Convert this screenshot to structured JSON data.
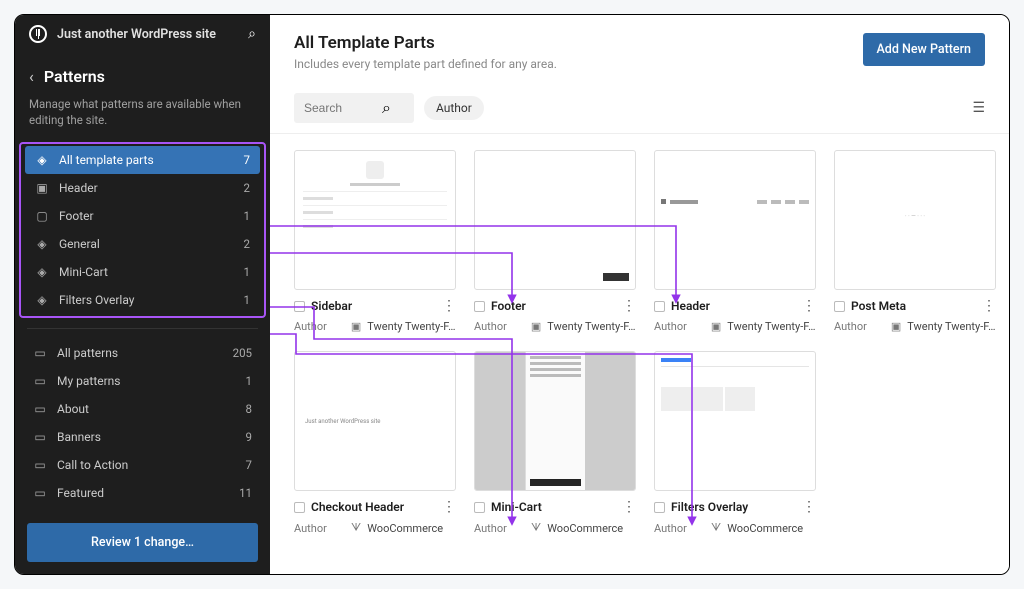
{
  "site_title": "Just another WordPress site",
  "sidebar": {
    "title": "Patterns",
    "description": "Manage what patterns are available when editing the site.",
    "template_parts": [
      {
        "icon": "◈",
        "label": "All template parts",
        "count": "7",
        "active": true
      },
      {
        "icon": "▣",
        "label": "Header",
        "count": "2"
      },
      {
        "icon": "▢",
        "label": "Footer",
        "count": "1"
      },
      {
        "icon": "◈",
        "label": "General",
        "count": "2"
      },
      {
        "icon": "◈",
        "label": "Mini-Cart",
        "count": "1"
      },
      {
        "icon": "◈",
        "label": "Filters Overlay",
        "count": "1"
      }
    ],
    "pattern_categories": [
      {
        "label": "All patterns",
        "count": "205"
      },
      {
        "label": "My patterns",
        "count": "1"
      },
      {
        "label": "About",
        "count": "8"
      },
      {
        "label": "Banners",
        "count": "9"
      },
      {
        "label": "Call to Action",
        "count": "7"
      },
      {
        "label": "Featured",
        "count": "11"
      }
    ],
    "review_label": "Review 1 change…"
  },
  "main": {
    "title": "All Template Parts",
    "subtitle": "Includes every template part defined for any area.",
    "add_button": "Add New Pattern",
    "search_placeholder": "Search",
    "filter_chip": "Author",
    "author_label": "Author",
    "theme_name": "Twenty Twenty-F…",
    "woo_name": "WooCommerce",
    "cards_row1": [
      {
        "title": "Sidebar",
        "source": "theme"
      },
      {
        "title": "Footer",
        "source": "theme"
      },
      {
        "title": "Header",
        "source": "theme"
      },
      {
        "title": "Post Meta",
        "source": "theme"
      }
    ],
    "cards_row2": [
      {
        "title": "Checkout Header",
        "source": "woo"
      },
      {
        "title": "Mini-Cart",
        "source": "woo"
      },
      {
        "title": "Filters Overlay",
        "source": "woo"
      }
    ]
  }
}
